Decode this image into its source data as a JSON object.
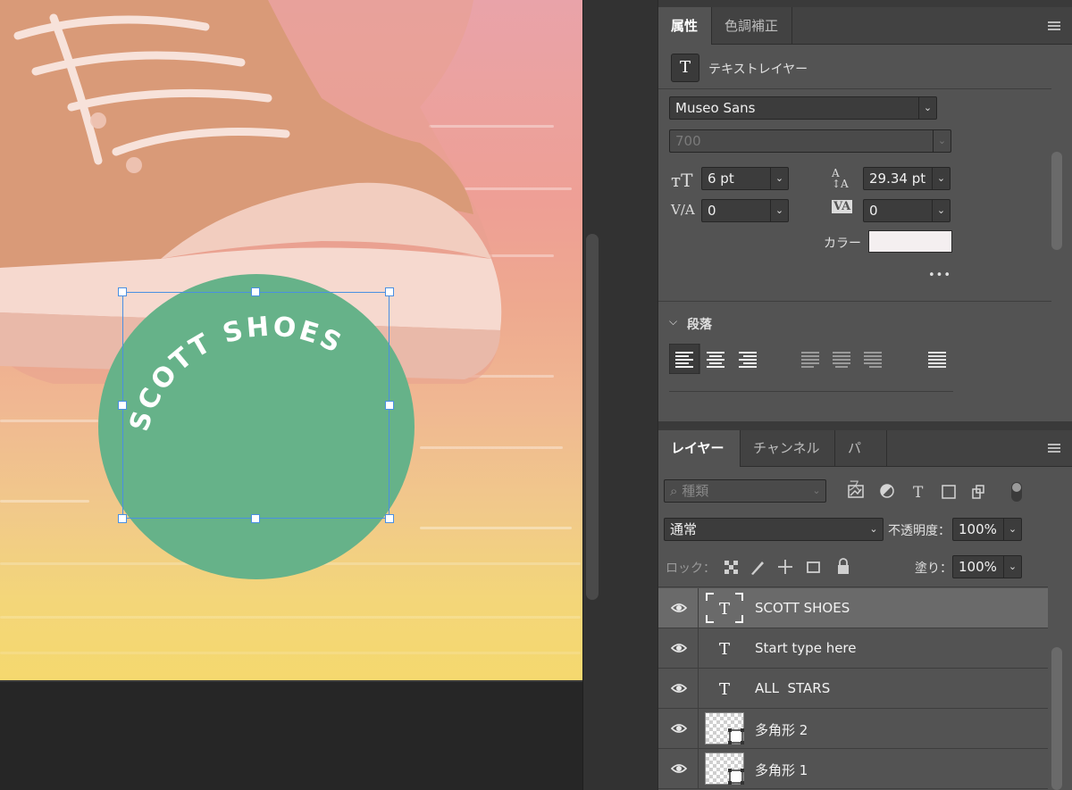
{
  "canvas": {
    "artwork_text": "SCOTT SHOES",
    "circle_color": "#66b289",
    "selection_color": "#4a90e2"
  },
  "properties_panel": {
    "tabs": [
      {
        "label": "属性",
        "active": true
      },
      {
        "label": "色調補正",
        "active": false
      }
    ],
    "layer_type_label": "テキストレイヤー",
    "font_family": "Museo Sans",
    "font_weight": "700",
    "font_size": "6 pt",
    "leading": "29.34 pt",
    "kerning": "0",
    "tracking": "0",
    "color_label": "カラー",
    "color_swatch": "#f4eff0",
    "more_label": "•••",
    "paragraph_label": "段落"
  },
  "layers_panel": {
    "tabs": [
      {
        "label": "レイヤー",
        "active": true
      },
      {
        "label": "チャンネル",
        "active": false
      },
      {
        "label": "パス",
        "active": false
      }
    ],
    "filter_placeholder": "種類",
    "blend_mode": "通常",
    "opacity_label": "不透明度：",
    "opacity_value": "100%",
    "lock_label": "ロック：",
    "fill_label": "塗り：",
    "fill_value": "100%",
    "layers": [
      {
        "name": "SCOTT SHOES",
        "kind": "text",
        "selected": true
      },
      {
        "name": "Start type here",
        "kind": "text",
        "selected": false
      },
      {
        "name": "ALL  STARS",
        "kind": "text",
        "selected": false
      },
      {
        "name": "多角形 2",
        "kind": "shape",
        "selected": false
      },
      {
        "name": "多角形 1",
        "kind": "shape",
        "selected": false
      }
    ]
  }
}
